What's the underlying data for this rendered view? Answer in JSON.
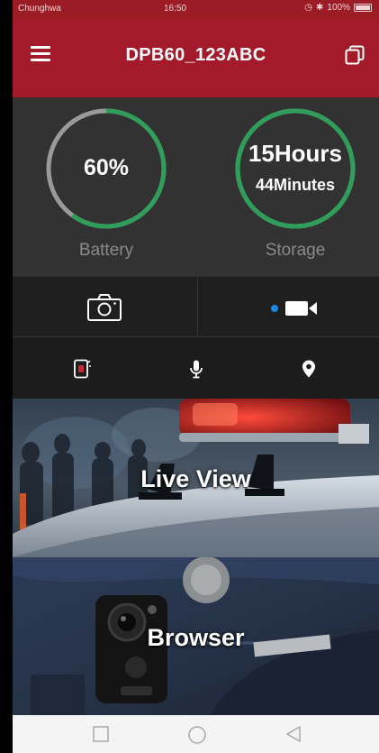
{
  "status_bar": {
    "carrier": "Chunghwa",
    "time": "16:50",
    "battery_pct": "100%"
  },
  "app_bar": {
    "title": "DPB60_123ABC"
  },
  "battery": {
    "value_label": "60%",
    "level": 0.6,
    "caption": "Battery"
  },
  "storage": {
    "hours_label": "15Hours",
    "minutes_label": "44Minutes",
    "level": 1.0,
    "caption": "Storage"
  },
  "colors": {
    "header_red": "#a31b2a",
    "gauge_green": "#2e9e5a",
    "gauge_track": "#9a9a9a",
    "record_dot": "#1e88e5"
  },
  "icons": {
    "menu": "hamburger-icon",
    "copy": "copy-icon",
    "photo": "camera-icon",
    "video": "video-camera-icon",
    "tag": "evidence-tag-icon",
    "mic": "microphone-icon",
    "location": "location-pin-icon"
  },
  "tiles": {
    "live_view": "Live View",
    "browser": "Browser"
  }
}
